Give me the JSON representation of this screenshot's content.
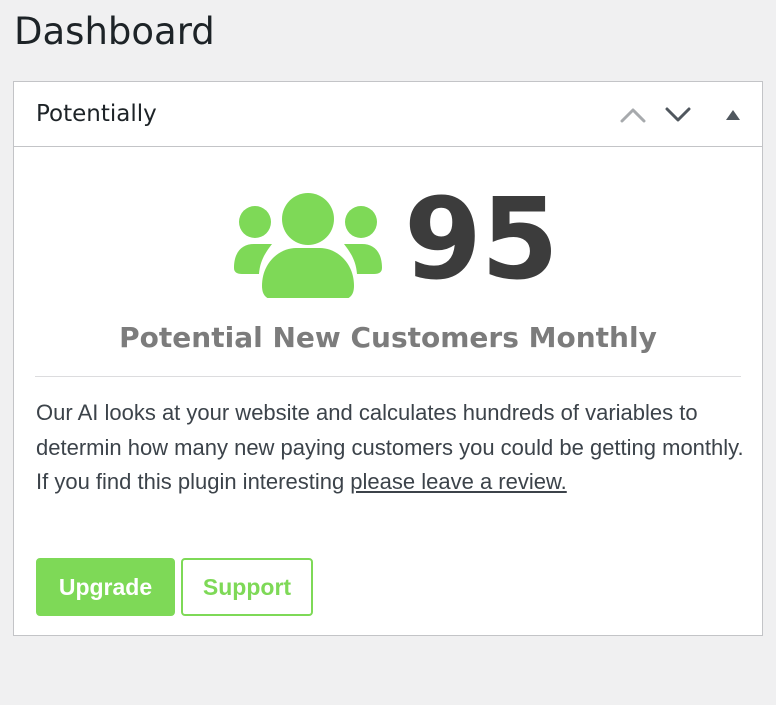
{
  "page": {
    "title": "Dashboard"
  },
  "widget": {
    "title": "Potentially",
    "controls": {
      "move_up_icon": "chevron-up-icon",
      "move_down_icon": "chevron-down-icon",
      "toggle_icon": "triangle-up-icon"
    },
    "stat": {
      "icon": "users-icon",
      "value": "95",
      "label": "Potential New Customers Monthly"
    },
    "description": {
      "text": "Our AI looks at your website and calculates hundreds of variables to determin how many new paying customers you could be getting monthly. If you find this plugin interesting ",
      "link_text": "please leave a review."
    },
    "buttons": {
      "upgrade_label": "Upgrade",
      "support_label": "Support"
    }
  },
  "colors": {
    "accent": "#7ed957",
    "stat_number": "#3c3c3c",
    "stat_label": "#7c7c7c",
    "background": "#f0f0f1"
  }
}
